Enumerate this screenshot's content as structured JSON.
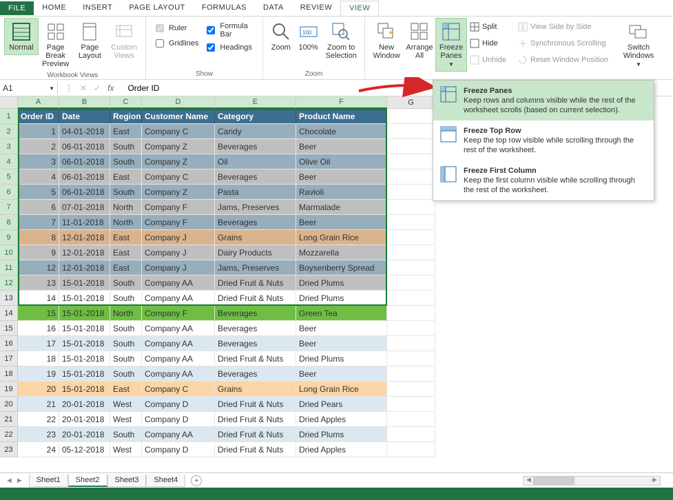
{
  "tabs": {
    "file": "FILE",
    "items": [
      "HOME",
      "INSERT",
      "PAGE LAYOUT",
      "FORMULAS",
      "DATA",
      "REVIEW",
      "VIEW"
    ],
    "active": "VIEW"
  },
  "ribbon": {
    "workbook_views": {
      "label": "Workbook Views",
      "normal": "Normal",
      "page_break": "Page Break Preview",
      "page_layout": "Page Layout",
      "custom": "Custom Views"
    },
    "show": {
      "label": "Show",
      "ruler": "Ruler",
      "gridlines": "Gridlines",
      "formula_bar": "Formula Bar",
      "headings": "Headings"
    },
    "zoom": {
      "label": "Zoom",
      "zoom": "Zoom",
      "hundred": "100%",
      "to_sel": "Zoom to Selection"
    },
    "window": {
      "new_window": "New Window",
      "arrange_all": "Arrange All",
      "freeze_panes": "Freeze Panes",
      "split": "Split",
      "hide": "Hide",
      "unhide": "Unhide",
      "side_by_side": "View Side by Side",
      "sync_scroll": "Synchronous Scrolling",
      "reset_pos": "Reset Window Position",
      "switch": "Switch Windows"
    }
  },
  "freeze_menu": {
    "panes": {
      "title": "Freeze Panes",
      "desc": "Keep rows and columns visible while the rest of the worksheet scrolls (based on current selection)."
    },
    "top_row": {
      "title": "Freeze Top Row",
      "desc": "Keep the top row visible while scrolling through the rest of the worksheet."
    },
    "first_col": {
      "title": "Freeze First Column",
      "desc": "Keep the first column visible while scrolling through the rest of the worksheet."
    }
  },
  "formula_bar": {
    "name_box": "A1",
    "content": "Order ID"
  },
  "columns": [
    "A",
    "B",
    "C",
    "D",
    "E",
    "F",
    "G"
  ],
  "table": {
    "headers": [
      "Order ID",
      "Date",
      "Region",
      "Customer Name",
      "Category",
      "Product Name"
    ],
    "rows": [
      {
        "n": 2,
        "band": "band-blue",
        "v": [
          "1",
          "04-01-2018",
          "East",
          "Company C",
          "Candy",
          "Chocolate"
        ]
      },
      {
        "n": 3,
        "band": "band-gray",
        "v": [
          "2",
          "06-01-2018",
          "South",
          "Company Z",
          "Beverages",
          "Beer"
        ]
      },
      {
        "n": 4,
        "band": "band-blue",
        "v": [
          "3",
          "06-01-2018",
          "South",
          "Company Z",
          "Oil",
          "Olive Oil"
        ]
      },
      {
        "n": 5,
        "band": "band-gray",
        "v": [
          "4",
          "06-01-2018",
          "East",
          "Company C",
          "Beverages",
          "Beer"
        ]
      },
      {
        "n": 6,
        "band": "band-blue",
        "v": [
          "5",
          "06-01-2018",
          "South",
          "Company Z",
          "Pasta",
          "Ravioli"
        ]
      },
      {
        "n": 7,
        "band": "band-gray",
        "v": [
          "6",
          "07-01-2018",
          "North",
          "Company F",
          "Jams, Preserves",
          "Marmalade"
        ]
      },
      {
        "n": 8,
        "band": "band-blue",
        "v": [
          "7",
          "11-01-2018",
          "North",
          "Company F",
          "Beverages",
          "Beer"
        ]
      },
      {
        "n": 9,
        "band": "band-tan",
        "v": [
          "8",
          "12-01-2018",
          "East",
          "Company J",
          "Grains",
          "Long Grain Rice"
        ]
      },
      {
        "n": 10,
        "band": "band-gray",
        "v": [
          "9",
          "12-01-2018",
          "East",
          "Company J",
          "Dairy Products",
          "Mozzarella"
        ]
      },
      {
        "n": 11,
        "band": "band-blue",
        "v": [
          "12",
          "12-01-2018",
          "East",
          "Company J",
          "Jams, Preserves",
          "Boysenberry Spread"
        ]
      },
      {
        "n": 12,
        "band": "band-gray",
        "v": [
          "13",
          "15-01-2018",
          "South",
          "Company AA",
          "Dried Fruit & Nuts",
          "Dried Plums"
        ]
      },
      {
        "n": 13,
        "band": "band-white",
        "v": [
          "14",
          "15-01-2018",
          "South",
          "Company AA",
          "Dried Fruit & Nuts",
          "Dried Plums"
        ]
      },
      {
        "n": 14,
        "band": "band-green",
        "v": [
          "15",
          "15-01-2018",
          "North",
          "Company F",
          "Beverages",
          "Green Tea"
        ]
      },
      {
        "n": 15,
        "band": "band-white",
        "v": [
          "16",
          "15-01-2018",
          "South",
          "Company AA",
          "Beverages",
          "Beer"
        ]
      },
      {
        "n": 16,
        "band": "band-light",
        "v": [
          "17",
          "15-01-2018",
          "South",
          "Company AA",
          "Beverages",
          "Beer"
        ]
      },
      {
        "n": 17,
        "band": "band-white",
        "v": [
          "18",
          "15-01-2018",
          "South",
          "Company AA",
          "Dried Fruit & Nuts",
          "Dried Plums"
        ]
      },
      {
        "n": 18,
        "band": "band-light",
        "v": [
          "19",
          "15-01-2018",
          "South",
          "Company AA",
          "Beverages",
          "Beer"
        ]
      },
      {
        "n": 19,
        "band": "band-orange",
        "v": [
          "20",
          "15-01-2018",
          "East",
          "Company C",
          "Grains",
          "Long Grain Rice"
        ]
      },
      {
        "n": 20,
        "band": "band-light",
        "v": [
          "21",
          "20-01-2018",
          "West",
          "Company D",
          "Dried Fruit & Nuts",
          "Dried Pears"
        ]
      },
      {
        "n": 21,
        "band": "band-white",
        "v": [
          "22",
          "20-01-2018",
          "West",
          "Company D",
          "Dried Fruit & Nuts",
          "Dried Apples"
        ]
      },
      {
        "n": 22,
        "band": "band-light",
        "v": [
          "23",
          "20-01-2018",
          "South",
          "Company AA",
          "Dried Fruit & Nuts",
          "Dried Plums"
        ]
      },
      {
        "n": 23,
        "band": "band-white",
        "v": [
          "24",
          "05-12-2018",
          "West",
          "Company D",
          "Dried Fruit & Nuts",
          "Dried Apples"
        ]
      }
    ]
  },
  "sheets": {
    "tabs": [
      "Sheet1",
      "Sheet2",
      "Sheet3",
      "Sheet4"
    ],
    "active": "Sheet2"
  }
}
